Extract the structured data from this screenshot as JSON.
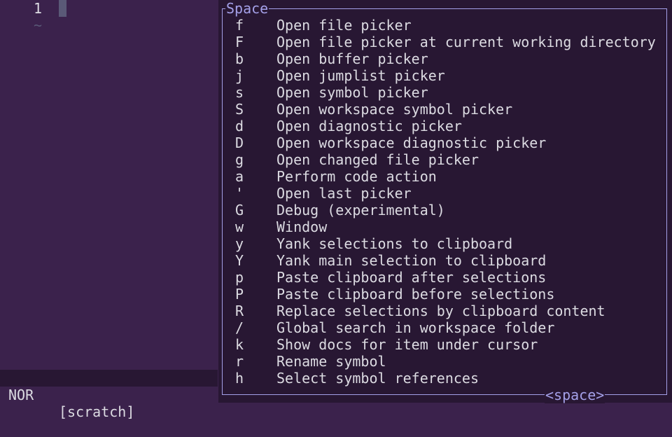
{
  "editor": {
    "line_number": "1",
    "empty_line_marker": "~"
  },
  "statusline": {
    "mode": "NOR",
    "buffer_name": "[scratch]"
  },
  "popup": {
    "title": "Space",
    "footer": "<space>",
    "items": [
      {
        "key": "f",
        "desc": "Open file picker"
      },
      {
        "key": "F",
        "desc": "Open file picker at current working directory"
      },
      {
        "key": "b",
        "desc": "Open buffer picker"
      },
      {
        "key": "j",
        "desc": "Open jumplist picker"
      },
      {
        "key": "s",
        "desc": "Open symbol picker"
      },
      {
        "key": "S",
        "desc": "Open workspace symbol picker"
      },
      {
        "key": "d",
        "desc": "Open diagnostic picker"
      },
      {
        "key": "D",
        "desc": "Open workspace diagnostic picker"
      },
      {
        "key": "g",
        "desc": "Open changed file picker"
      },
      {
        "key": "a",
        "desc": "Perform code action"
      },
      {
        "key": "'",
        "desc": "Open last picker"
      },
      {
        "key": "G",
        "desc": "Debug (experimental)"
      },
      {
        "key": "w",
        "desc": "Window"
      },
      {
        "key": "y",
        "desc": "Yank selections to clipboard"
      },
      {
        "key": "Y",
        "desc": "Yank main selection to clipboard"
      },
      {
        "key": "p",
        "desc": "Paste clipboard after selections"
      },
      {
        "key": "P",
        "desc": "Paste clipboard before selections"
      },
      {
        "key": "R",
        "desc": "Replace selections by clipboard content"
      },
      {
        "key": "/",
        "desc": "Global search in workspace folder"
      },
      {
        "key": "k",
        "desc": "Show docs for item under cursor"
      },
      {
        "key": "r",
        "desc": "Rename symbol"
      },
      {
        "key": "h",
        "desc": "Select symbol references"
      }
    ]
  },
  "colors": {
    "editor_background": "#3b224c",
    "popup_background": "#281733",
    "text": "#dcdbe2",
    "border": "#a4a0e8",
    "cursor": "#5a5977"
  }
}
